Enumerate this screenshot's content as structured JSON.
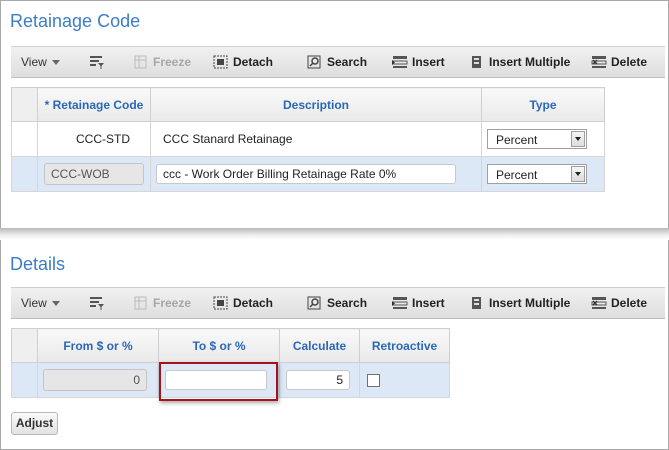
{
  "retainage": {
    "title": "Retainage Code",
    "toolbar": {
      "view": "View",
      "freeze": "Freeze",
      "detach": "Detach",
      "search": "Search",
      "insert": "Insert",
      "insert_multiple": "Insert Multiple",
      "delete": "Delete"
    },
    "columns": [
      "* Retainage Code",
      "Description",
      "Type"
    ],
    "rows": [
      {
        "code": "CCC-STD",
        "description": "CCC Stanard Retainage",
        "type": "Percent"
      },
      {
        "code": "CCC-WOB",
        "description": "ccc - Work Order Billing Retainage Rate 0%",
        "type": "Percent"
      }
    ]
  },
  "details": {
    "title": "Details",
    "toolbar": {
      "view": "View",
      "freeze": "Freeze",
      "detach": "Detach",
      "search": "Search",
      "insert": "Insert",
      "insert_multiple": "Insert Multiple",
      "delete": "Delete"
    },
    "columns": [
      "From $ or %",
      "To $ or %",
      "Calculate",
      "Retroactive"
    ],
    "row": {
      "from": "0",
      "to": "",
      "calculate": "5",
      "retroactive": false
    },
    "adjust_label": "Adjust"
  },
  "colors": {
    "accent": "#3b7dc8",
    "header_text": "#2a68b5",
    "selected_row": "#dde8f6",
    "highlight": "#a8121a"
  }
}
